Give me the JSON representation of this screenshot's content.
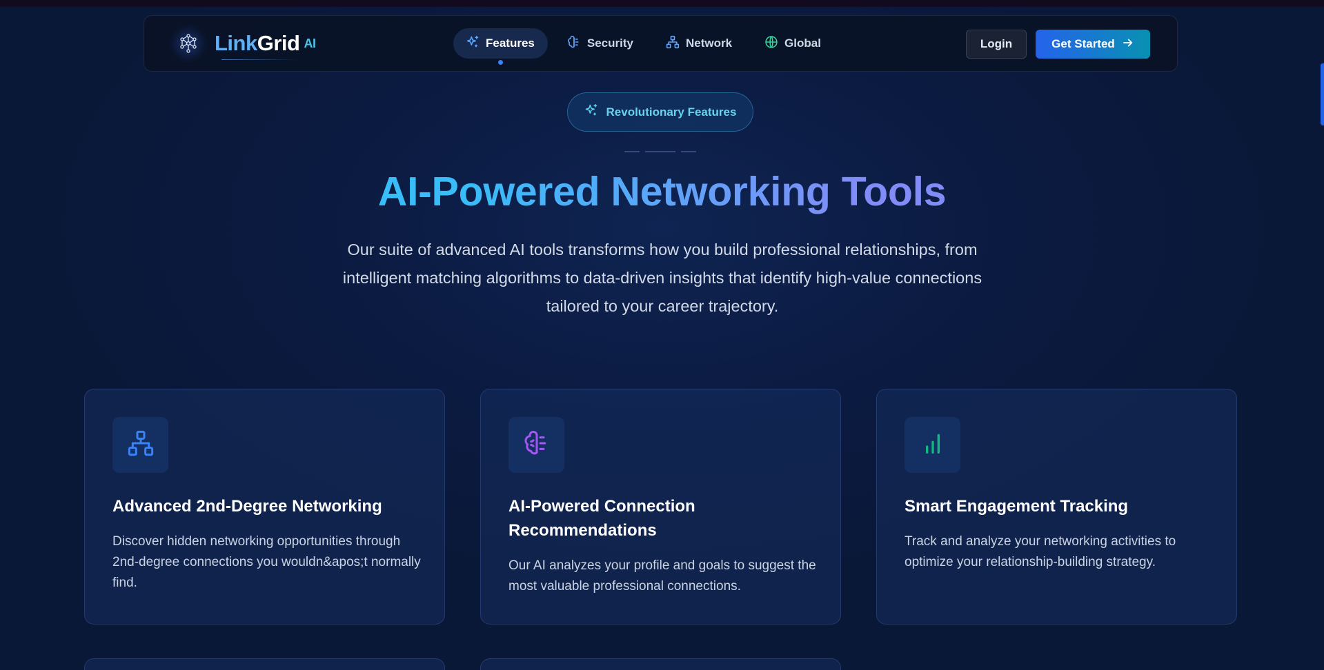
{
  "brand": {
    "name_part1": "Link",
    "name_part2": "Grid",
    "suffix": "AI"
  },
  "nav": {
    "links": [
      {
        "label": "Features",
        "icon": "sparkles-icon",
        "active": true
      },
      {
        "label": "Security",
        "icon": "brain-icon",
        "active": false
      },
      {
        "label": "Network",
        "icon": "network-icon",
        "active": false
      },
      {
        "label": "Global",
        "icon": "globe-icon",
        "active": false
      }
    ],
    "login_label": "Login",
    "get_started_label": "Get Started"
  },
  "hero": {
    "badge": "Revolutionary Features",
    "title": "AI-Powered Networking Tools",
    "description": "Our suite of advanced AI tools transforms how you build professional relationships, from intelligent matching algorithms to data-driven insights that identify high-value connections tailored to your career trajectory."
  },
  "cards": [
    {
      "icon": "network-icon",
      "icon_color": "#3b82f6",
      "title": "Advanced 2nd-Degree Networking",
      "text": "Discover hidden networking opportunities through 2nd-degree connections you wouldn&apos;t normally find."
    },
    {
      "icon": "brain-icon",
      "icon_color": "#a855f7",
      "title": "AI-Powered Connection Recommendations",
      "text": "Our AI analyzes your profile and goals to suggest the most valuable professional connections."
    },
    {
      "icon": "bar-chart-icon",
      "icon_color": "#10b981",
      "title": "Smart Engagement Tracking",
      "text": "Track and analyze your networking activities to optimize your relationship-building strategy."
    }
  ],
  "colors": {
    "background": "#0b1a40",
    "accent_blue": "#2563eb",
    "accent_cyan": "#0891b2",
    "title_gradient_start": "#38bdf8",
    "title_gradient_end": "#818cf8"
  }
}
